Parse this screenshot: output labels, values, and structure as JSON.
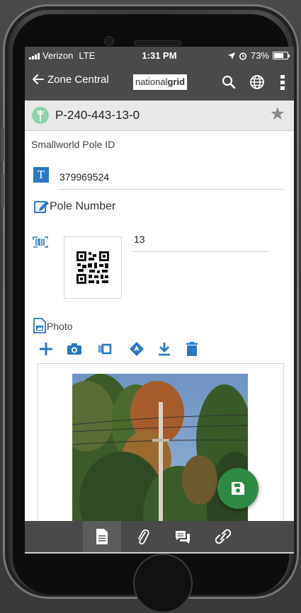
{
  "status_bar": {
    "carrier": "Verizon",
    "network": "LTE",
    "time": "1:31 PM",
    "battery": "73%",
    "battery_level": 0.73,
    "icons": [
      "signal-icon",
      "location-arrow-icon",
      "alarm-icon",
      "battery-icon"
    ]
  },
  "app_bar": {
    "back_label": "Zone Central",
    "logo_text_light": "national",
    "logo_text_bold": "grid",
    "icons": [
      "back-arrow-icon",
      "search-icon",
      "globe-icon",
      "more-vert-icon"
    ]
  },
  "record": {
    "title": "P-240-443-13-0",
    "icon": "pole-icon",
    "favorite_icon": "star-icon"
  },
  "fields": {
    "smallworld_label": "Smallworld Pole ID",
    "smallworld_value": "379969524",
    "pole_number_label": "Pole Number",
    "pole_number_value": "13",
    "photo_label": "Photo"
  },
  "photo_toolbar": [
    "add-icon",
    "camera-icon",
    "scan-icon",
    "navigate-icon",
    "download-icon",
    "delete-icon"
  ],
  "bottom_nav": {
    "items": [
      "document-icon",
      "attachment-icon",
      "comments-icon",
      "link-icon"
    ],
    "active_index": 0
  },
  "fab": {
    "icon": "save-icon"
  },
  "colors": {
    "bar": "#4a4a4a",
    "accent_blue": "#2a78c4",
    "fab_green": "#2e8a45",
    "record_icon": "#8fd1a8"
  }
}
